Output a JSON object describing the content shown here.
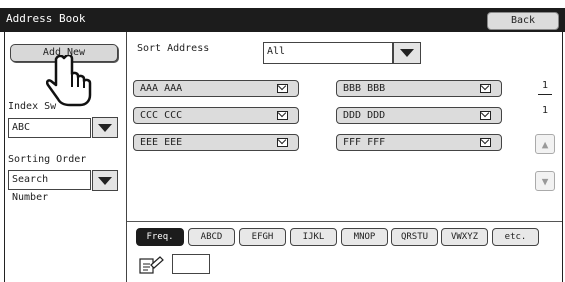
{
  "window": {
    "title": "Address Book",
    "back_label": "Back"
  },
  "left_panel": {
    "add_new_label": "Add New",
    "index_switch_label": "Index Sw",
    "index_switch_value": "ABC",
    "sorting_order_label": "Sorting Order",
    "sorting_order_value": "Search Number"
  },
  "sort_address": {
    "label": "Sort Address",
    "value": "All"
  },
  "entries": [
    {
      "name": "AAA AAA",
      "icon": "envelope-icon"
    },
    {
      "name": "BBB BBB",
      "icon": "envelope-icon"
    },
    {
      "name": "CCC CCC",
      "icon": "envelope-icon"
    },
    {
      "name": "DDD DDD",
      "icon": "envelope-icon"
    },
    {
      "name": "EEE EEE",
      "icon": "envelope-icon"
    },
    {
      "name": "FFF FFF",
      "icon": "envelope-icon"
    }
  ],
  "pagination": {
    "current": "1",
    "total": "1"
  },
  "index_tabs": [
    {
      "label": "Freq.",
      "active": true
    },
    {
      "label": "ABCD"
    },
    {
      "label": "EFGH"
    },
    {
      "label": "IJKL"
    },
    {
      "label": "MNOP"
    },
    {
      "label": "QRSTU"
    },
    {
      "label": "VWXYZ"
    },
    {
      "label": "etc."
    }
  ]
}
